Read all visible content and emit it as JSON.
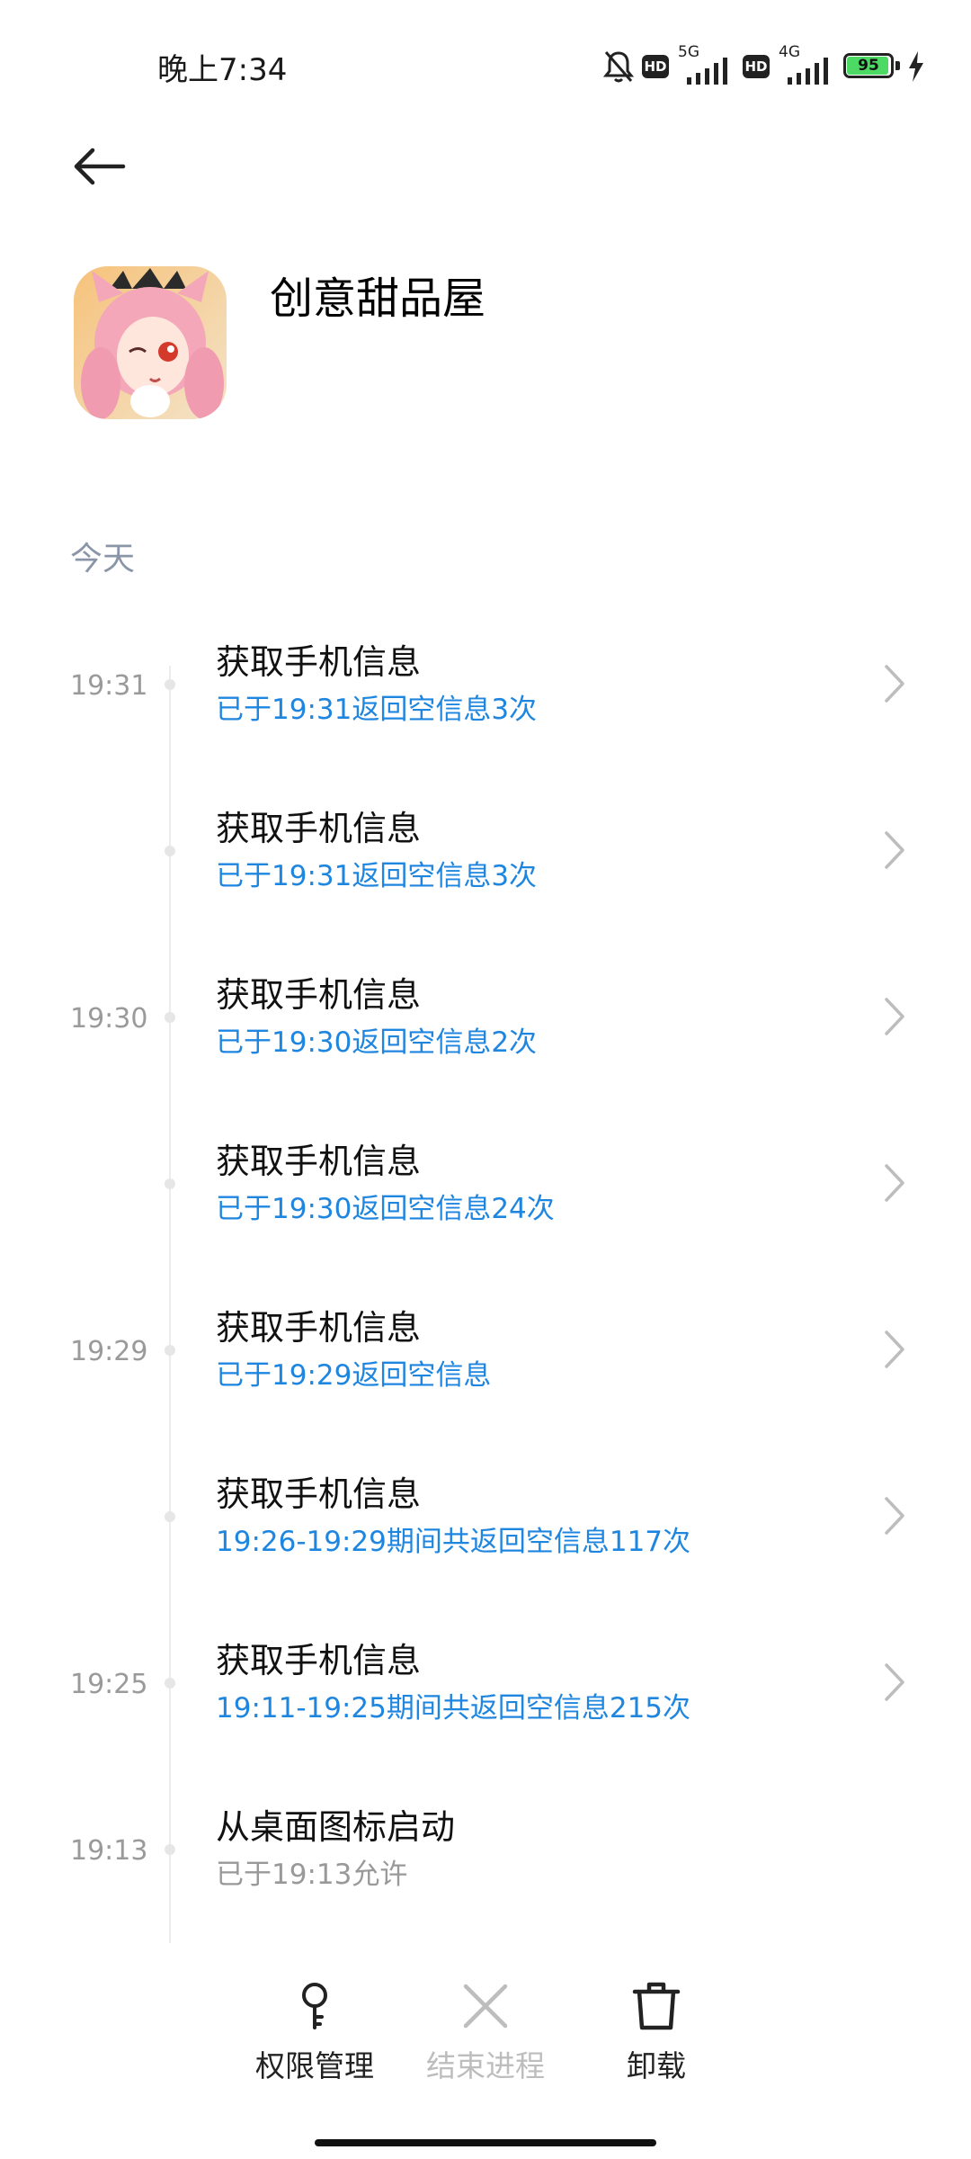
{
  "status_bar": {
    "time": "晚上7:34",
    "hd_label": "HD",
    "network_1": "5G",
    "network_2": "4G",
    "battery_level": 95,
    "battery_text": "95",
    "icons": [
      "mute-bell-icon",
      "hd-icon",
      "signal-5g-icon",
      "hd-icon",
      "signal-4g-icon",
      "battery-icon",
      "charging-bolt-icon"
    ]
  },
  "header": {
    "back_icon": "arrow-left-icon",
    "app_name": "创意甜品屋",
    "app_icon": "app-icon-anime-girl"
  },
  "section_label": "今天",
  "entries": [
    {
      "time": "19:31",
      "title": "获取手机信息",
      "subtitle": "已于19:31返回空信息3次",
      "subtitle_color": "blue",
      "has_chevron": true
    },
    {
      "time": "",
      "title": "获取手机信息",
      "subtitle": "已于19:31返回空信息3次",
      "subtitle_color": "blue",
      "has_chevron": true
    },
    {
      "time": "19:30",
      "title": "获取手机信息",
      "subtitle": "已于19:30返回空信息2次",
      "subtitle_color": "blue",
      "has_chevron": true
    },
    {
      "time": "",
      "title": "获取手机信息",
      "subtitle": "已于19:30返回空信息24次",
      "subtitle_color": "blue",
      "has_chevron": true
    },
    {
      "time": "19:29",
      "title": "获取手机信息",
      "subtitle": "已于19:29返回空信息",
      "subtitle_color": "blue",
      "has_chevron": true
    },
    {
      "time": "",
      "title": "获取手机信息",
      "subtitle": "19:26-19:29期间共返回空信息117次",
      "subtitle_color": "blue",
      "has_chevron": true
    },
    {
      "time": "19:25",
      "title": "获取手机信息",
      "subtitle": "19:11-19:25期间共返回空信息215次",
      "subtitle_color": "blue",
      "has_chevron": true
    },
    {
      "time": "19:13",
      "title": "从桌面图标启动",
      "subtitle": "已于19:13允许",
      "subtitle_color": "gray",
      "has_chevron": false
    }
  ],
  "actions": {
    "permissions": {
      "label": "权限管理",
      "icon": "key-icon"
    },
    "end_process": {
      "label": "结束进程",
      "icon": "close-x-icon",
      "enabled": false
    },
    "uninstall": {
      "label": "卸载",
      "icon": "trash-icon"
    }
  },
  "colors": {
    "accent_blue": "#1f86e0",
    "section_gray": "#8a96a8",
    "battery_green": "#4cd964"
  }
}
